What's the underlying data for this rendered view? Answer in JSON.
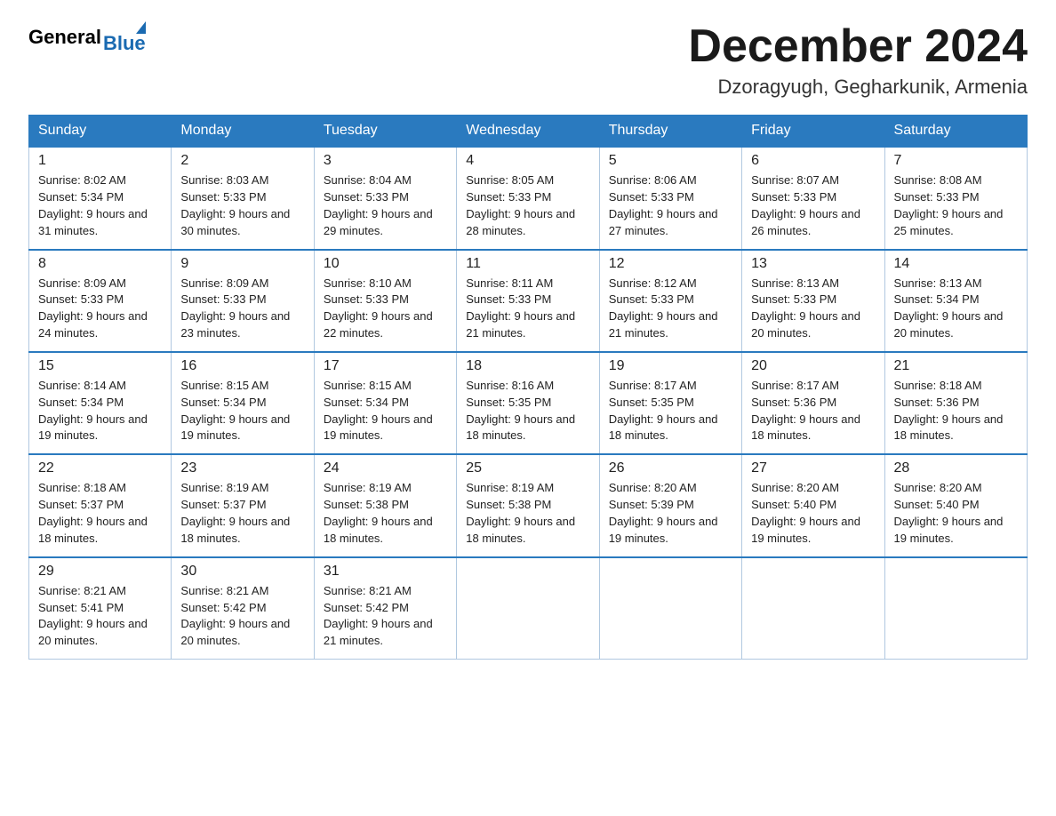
{
  "logo": {
    "general": "General",
    "blue": "Blue",
    "triangle_color": "#1a6ab1"
  },
  "header": {
    "month_title": "December 2024",
    "location": "Dzoragyugh, Gegharkunik, Armenia"
  },
  "weekdays": [
    "Sunday",
    "Monday",
    "Tuesday",
    "Wednesday",
    "Thursday",
    "Friday",
    "Saturday"
  ],
  "weeks": [
    [
      {
        "day": "1",
        "sunrise": "Sunrise: 8:02 AM",
        "sunset": "Sunset: 5:34 PM",
        "daylight": "Daylight: 9 hours and 31 minutes."
      },
      {
        "day": "2",
        "sunrise": "Sunrise: 8:03 AM",
        "sunset": "Sunset: 5:33 PM",
        "daylight": "Daylight: 9 hours and 30 minutes."
      },
      {
        "day": "3",
        "sunrise": "Sunrise: 8:04 AM",
        "sunset": "Sunset: 5:33 PM",
        "daylight": "Daylight: 9 hours and 29 minutes."
      },
      {
        "day": "4",
        "sunrise": "Sunrise: 8:05 AM",
        "sunset": "Sunset: 5:33 PM",
        "daylight": "Daylight: 9 hours and 28 minutes."
      },
      {
        "day": "5",
        "sunrise": "Sunrise: 8:06 AM",
        "sunset": "Sunset: 5:33 PM",
        "daylight": "Daylight: 9 hours and 27 minutes."
      },
      {
        "day": "6",
        "sunrise": "Sunrise: 8:07 AM",
        "sunset": "Sunset: 5:33 PM",
        "daylight": "Daylight: 9 hours and 26 minutes."
      },
      {
        "day": "7",
        "sunrise": "Sunrise: 8:08 AM",
        "sunset": "Sunset: 5:33 PM",
        "daylight": "Daylight: 9 hours and 25 minutes."
      }
    ],
    [
      {
        "day": "8",
        "sunrise": "Sunrise: 8:09 AM",
        "sunset": "Sunset: 5:33 PM",
        "daylight": "Daylight: 9 hours and 24 minutes."
      },
      {
        "day": "9",
        "sunrise": "Sunrise: 8:09 AM",
        "sunset": "Sunset: 5:33 PM",
        "daylight": "Daylight: 9 hours and 23 minutes."
      },
      {
        "day": "10",
        "sunrise": "Sunrise: 8:10 AM",
        "sunset": "Sunset: 5:33 PM",
        "daylight": "Daylight: 9 hours and 22 minutes."
      },
      {
        "day": "11",
        "sunrise": "Sunrise: 8:11 AM",
        "sunset": "Sunset: 5:33 PM",
        "daylight": "Daylight: 9 hours and 21 minutes."
      },
      {
        "day": "12",
        "sunrise": "Sunrise: 8:12 AM",
        "sunset": "Sunset: 5:33 PM",
        "daylight": "Daylight: 9 hours and 21 minutes."
      },
      {
        "day": "13",
        "sunrise": "Sunrise: 8:13 AM",
        "sunset": "Sunset: 5:33 PM",
        "daylight": "Daylight: 9 hours and 20 minutes."
      },
      {
        "day": "14",
        "sunrise": "Sunrise: 8:13 AM",
        "sunset": "Sunset: 5:34 PM",
        "daylight": "Daylight: 9 hours and 20 minutes."
      }
    ],
    [
      {
        "day": "15",
        "sunrise": "Sunrise: 8:14 AM",
        "sunset": "Sunset: 5:34 PM",
        "daylight": "Daylight: 9 hours and 19 minutes."
      },
      {
        "day": "16",
        "sunrise": "Sunrise: 8:15 AM",
        "sunset": "Sunset: 5:34 PM",
        "daylight": "Daylight: 9 hours and 19 minutes."
      },
      {
        "day": "17",
        "sunrise": "Sunrise: 8:15 AM",
        "sunset": "Sunset: 5:34 PM",
        "daylight": "Daylight: 9 hours and 19 minutes."
      },
      {
        "day": "18",
        "sunrise": "Sunrise: 8:16 AM",
        "sunset": "Sunset: 5:35 PM",
        "daylight": "Daylight: 9 hours and 18 minutes."
      },
      {
        "day": "19",
        "sunrise": "Sunrise: 8:17 AM",
        "sunset": "Sunset: 5:35 PM",
        "daylight": "Daylight: 9 hours and 18 minutes."
      },
      {
        "day": "20",
        "sunrise": "Sunrise: 8:17 AM",
        "sunset": "Sunset: 5:36 PM",
        "daylight": "Daylight: 9 hours and 18 minutes."
      },
      {
        "day": "21",
        "sunrise": "Sunrise: 8:18 AM",
        "sunset": "Sunset: 5:36 PM",
        "daylight": "Daylight: 9 hours and 18 minutes."
      }
    ],
    [
      {
        "day": "22",
        "sunrise": "Sunrise: 8:18 AM",
        "sunset": "Sunset: 5:37 PM",
        "daylight": "Daylight: 9 hours and 18 minutes."
      },
      {
        "day": "23",
        "sunrise": "Sunrise: 8:19 AM",
        "sunset": "Sunset: 5:37 PM",
        "daylight": "Daylight: 9 hours and 18 minutes."
      },
      {
        "day": "24",
        "sunrise": "Sunrise: 8:19 AM",
        "sunset": "Sunset: 5:38 PM",
        "daylight": "Daylight: 9 hours and 18 minutes."
      },
      {
        "day": "25",
        "sunrise": "Sunrise: 8:19 AM",
        "sunset": "Sunset: 5:38 PM",
        "daylight": "Daylight: 9 hours and 18 minutes."
      },
      {
        "day": "26",
        "sunrise": "Sunrise: 8:20 AM",
        "sunset": "Sunset: 5:39 PM",
        "daylight": "Daylight: 9 hours and 19 minutes."
      },
      {
        "day": "27",
        "sunrise": "Sunrise: 8:20 AM",
        "sunset": "Sunset: 5:40 PM",
        "daylight": "Daylight: 9 hours and 19 minutes."
      },
      {
        "day": "28",
        "sunrise": "Sunrise: 8:20 AM",
        "sunset": "Sunset: 5:40 PM",
        "daylight": "Daylight: 9 hours and 19 minutes."
      }
    ],
    [
      {
        "day": "29",
        "sunrise": "Sunrise: 8:21 AM",
        "sunset": "Sunset: 5:41 PM",
        "daylight": "Daylight: 9 hours and 20 minutes."
      },
      {
        "day": "30",
        "sunrise": "Sunrise: 8:21 AM",
        "sunset": "Sunset: 5:42 PM",
        "daylight": "Daylight: 9 hours and 20 minutes."
      },
      {
        "day": "31",
        "sunrise": "Sunrise: 8:21 AM",
        "sunset": "Sunset: 5:42 PM",
        "daylight": "Daylight: 9 hours and 21 minutes."
      },
      null,
      null,
      null,
      null
    ]
  ]
}
